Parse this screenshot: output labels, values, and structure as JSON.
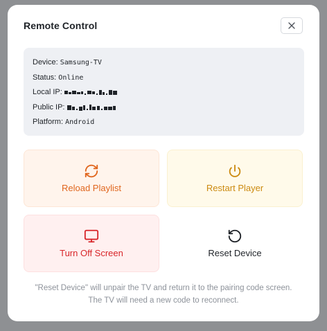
{
  "modal": {
    "title": "Remote Control",
    "close_icon": "close-icon"
  },
  "info": {
    "device_label": "Device:",
    "device_value": "Samsung-TV",
    "status_label": "Status:",
    "status_value": "Online",
    "local_ip_label": "Local IP:",
    "public_ip_label": "Public IP:",
    "platform_label": "Platform:",
    "platform_value": "Android"
  },
  "actions": {
    "reload_label": "Reload Playlist",
    "reload_icon": "refresh-icon",
    "restart_label": "Restart Player",
    "restart_icon": "power-icon",
    "turnoff_label": "Turn Off Screen",
    "turnoff_icon": "monitor-icon",
    "reset_label": "Reset Device",
    "reset_icon": "rotate-ccw-icon"
  },
  "footnote": {
    "line1": "\"Reset Device\" will unpair the TV and return it to the pairing code screen.",
    "line2": "The TV will need a new code to reconnect."
  },
  "colors": {
    "reload": "#e0661e",
    "restart": "#cc8a10",
    "turnoff": "#d8262a",
    "reset": "#1f2328"
  }
}
